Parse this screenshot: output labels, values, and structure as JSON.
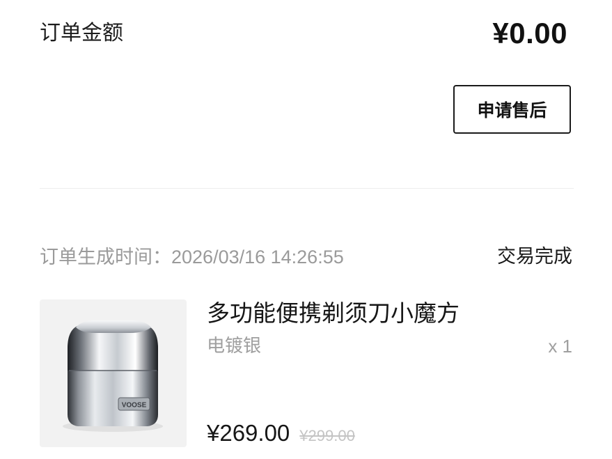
{
  "order": {
    "amount_label": "订单金额",
    "amount_value": "¥0.00",
    "after_sale_button": "申请售后",
    "created_time_label": "订单生成时间：",
    "created_time_value": "2026/03/16 14:26:55",
    "status": "交易完成"
  },
  "product": {
    "title": "多功能便携剃须刀小魔方",
    "variant": "电镀银",
    "quantity": "x 1",
    "price": "¥269.00",
    "original_price": "¥299.00",
    "image_icon": "silver-cube-shaver-image",
    "brand_mark": "VOOSE"
  },
  "colors": {
    "text_primary": "#161616",
    "text_secondary": "#9a9a9a",
    "thumb_bg": "#f2f2f2",
    "divider": "#ededed"
  }
}
